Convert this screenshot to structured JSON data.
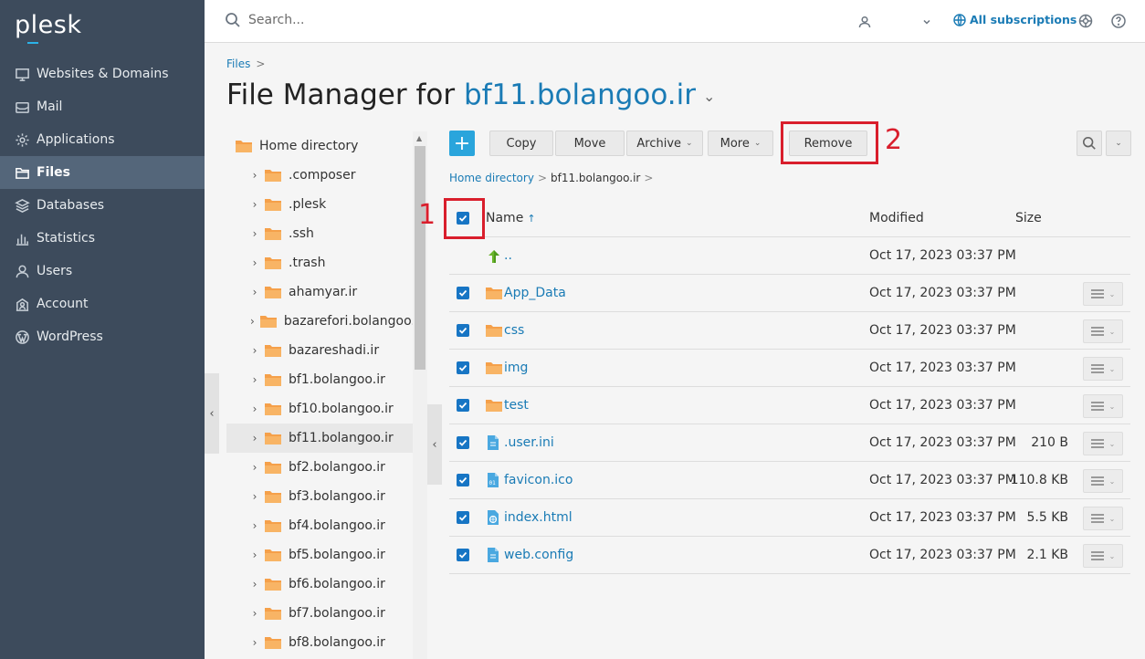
{
  "logo": "plesk",
  "sidebar": {
    "items": [
      {
        "label": "Websites & Domains",
        "icon": "monitor-icon"
      },
      {
        "label": "Mail",
        "icon": "mail-icon"
      },
      {
        "label": "Applications",
        "icon": "gear-icon"
      },
      {
        "label": "Files",
        "icon": "folder-icon",
        "active": true
      },
      {
        "label": "Databases",
        "icon": "database-icon"
      },
      {
        "label": "Statistics",
        "icon": "bar-chart-icon"
      },
      {
        "label": "Users",
        "icon": "user-icon"
      },
      {
        "label": "Account",
        "icon": "account-icon"
      },
      {
        "label": "WordPress",
        "icon": "wordpress-icon"
      }
    ]
  },
  "header": {
    "search_placeholder": "Search...",
    "subscriptions_label": "All subscriptions"
  },
  "breadcrumb": {
    "root": "Files",
    "sep": ">"
  },
  "title": {
    "prefix": "File Manager for ",
    "domain": "bf11.bolangoo.ir",
    "caret": "⌄"
  },
  "tree": {
    "root": "Home directory",
    "items": [
      ".composer",
      ".plesk",
      ".ssh",
      ".trash",
      "ahamyar.ir",
      "bazarefori.bolangoo.",
      "bazareshadi.ir",
      "bf1.bolangoo.ir",
      "bf10.bolangoo.ir",
      "bf11.bolangoo.ir",
      "bf2.bolangoo.ir",
      "bf3.bolangoo.ir",
      "bf4.bolangoo.ir",
      "bf5.bolangoo.ir",
      "bf6.bolangoo.ir",
      "bf7.bolangoo.ir",
      "bf8.bolangoo.ir"
    ],
    "selected": "bf11.bolangoo.ir"
  },
  "toolbar": {
    "add_label": "+",
    "copy": "Copy",
    "move": "Move",
    "archive": "Archive",
    "more": "More",
    "remove": "Remove"
  },
  "path": {
    "root": "Home directory",
    "current": "bf11.bolangoo.ir",
    "sep": ">"
  },
  "table": {
    "headers": {
      "name": "Name",
      "sort": "↑",
      "modified": "Modified",
      "size": "Size"
    },
    "parent": {
      "name": "..",
      "modified": "Oct 17, 2023 03:37 PM"
    },
    "rows": [
      {
        "name": "App_Data",
        "modified": "Oct 17, 2023 03:37 PM",
        "size": "",
        "type": "folder"
      },
      {
        "name": "css",
        "modified": "Oct 17, 2023 03:37 PM",
        "size": "",
        "type": "folder"
      },
      {
        "name": "img",
        "modified": "Oct 17, 2023 03:37 PM",
        "size": "",
        "type": "folder"
      },
      {
        "name": "test",
        "modified": "Oct 17, 2023 03:37 PM",
        "size": "",
        "type": "folder"
      },
      {
        "name": ".user.ini",
        "modified": "Oct 17, 2023 03:37 PM",
        "size": "210 B",
        "type": "file"
      },
      {
        "name": "favicon.ico",
        "modified": "Oct 17, 2023 03:37 PM",
        "size": "110.8 KB",
        "type": "binary"
      },
      {
        "name": "index.html",
        "modified": "Oct 17, 2023 03:37 PM",
        "size": "5.5 KB",
        "type": "html"
      },
      {
        "name": "web.config",
        "modified": "Oct 17, 2023 03:37 PM",
        "size": "2.1 KB",
        "type": "file"
      }
    ]
  },
  "annotations": {
    "one": "1",
    "two": "2"
  },
  "colors": {
    "accent": "#1a7bb5",
    "sidebar": "#3d4b5c",
    "highlight": "#d91e2c",
    "add_button": "#2aa5dc"
  }
}
